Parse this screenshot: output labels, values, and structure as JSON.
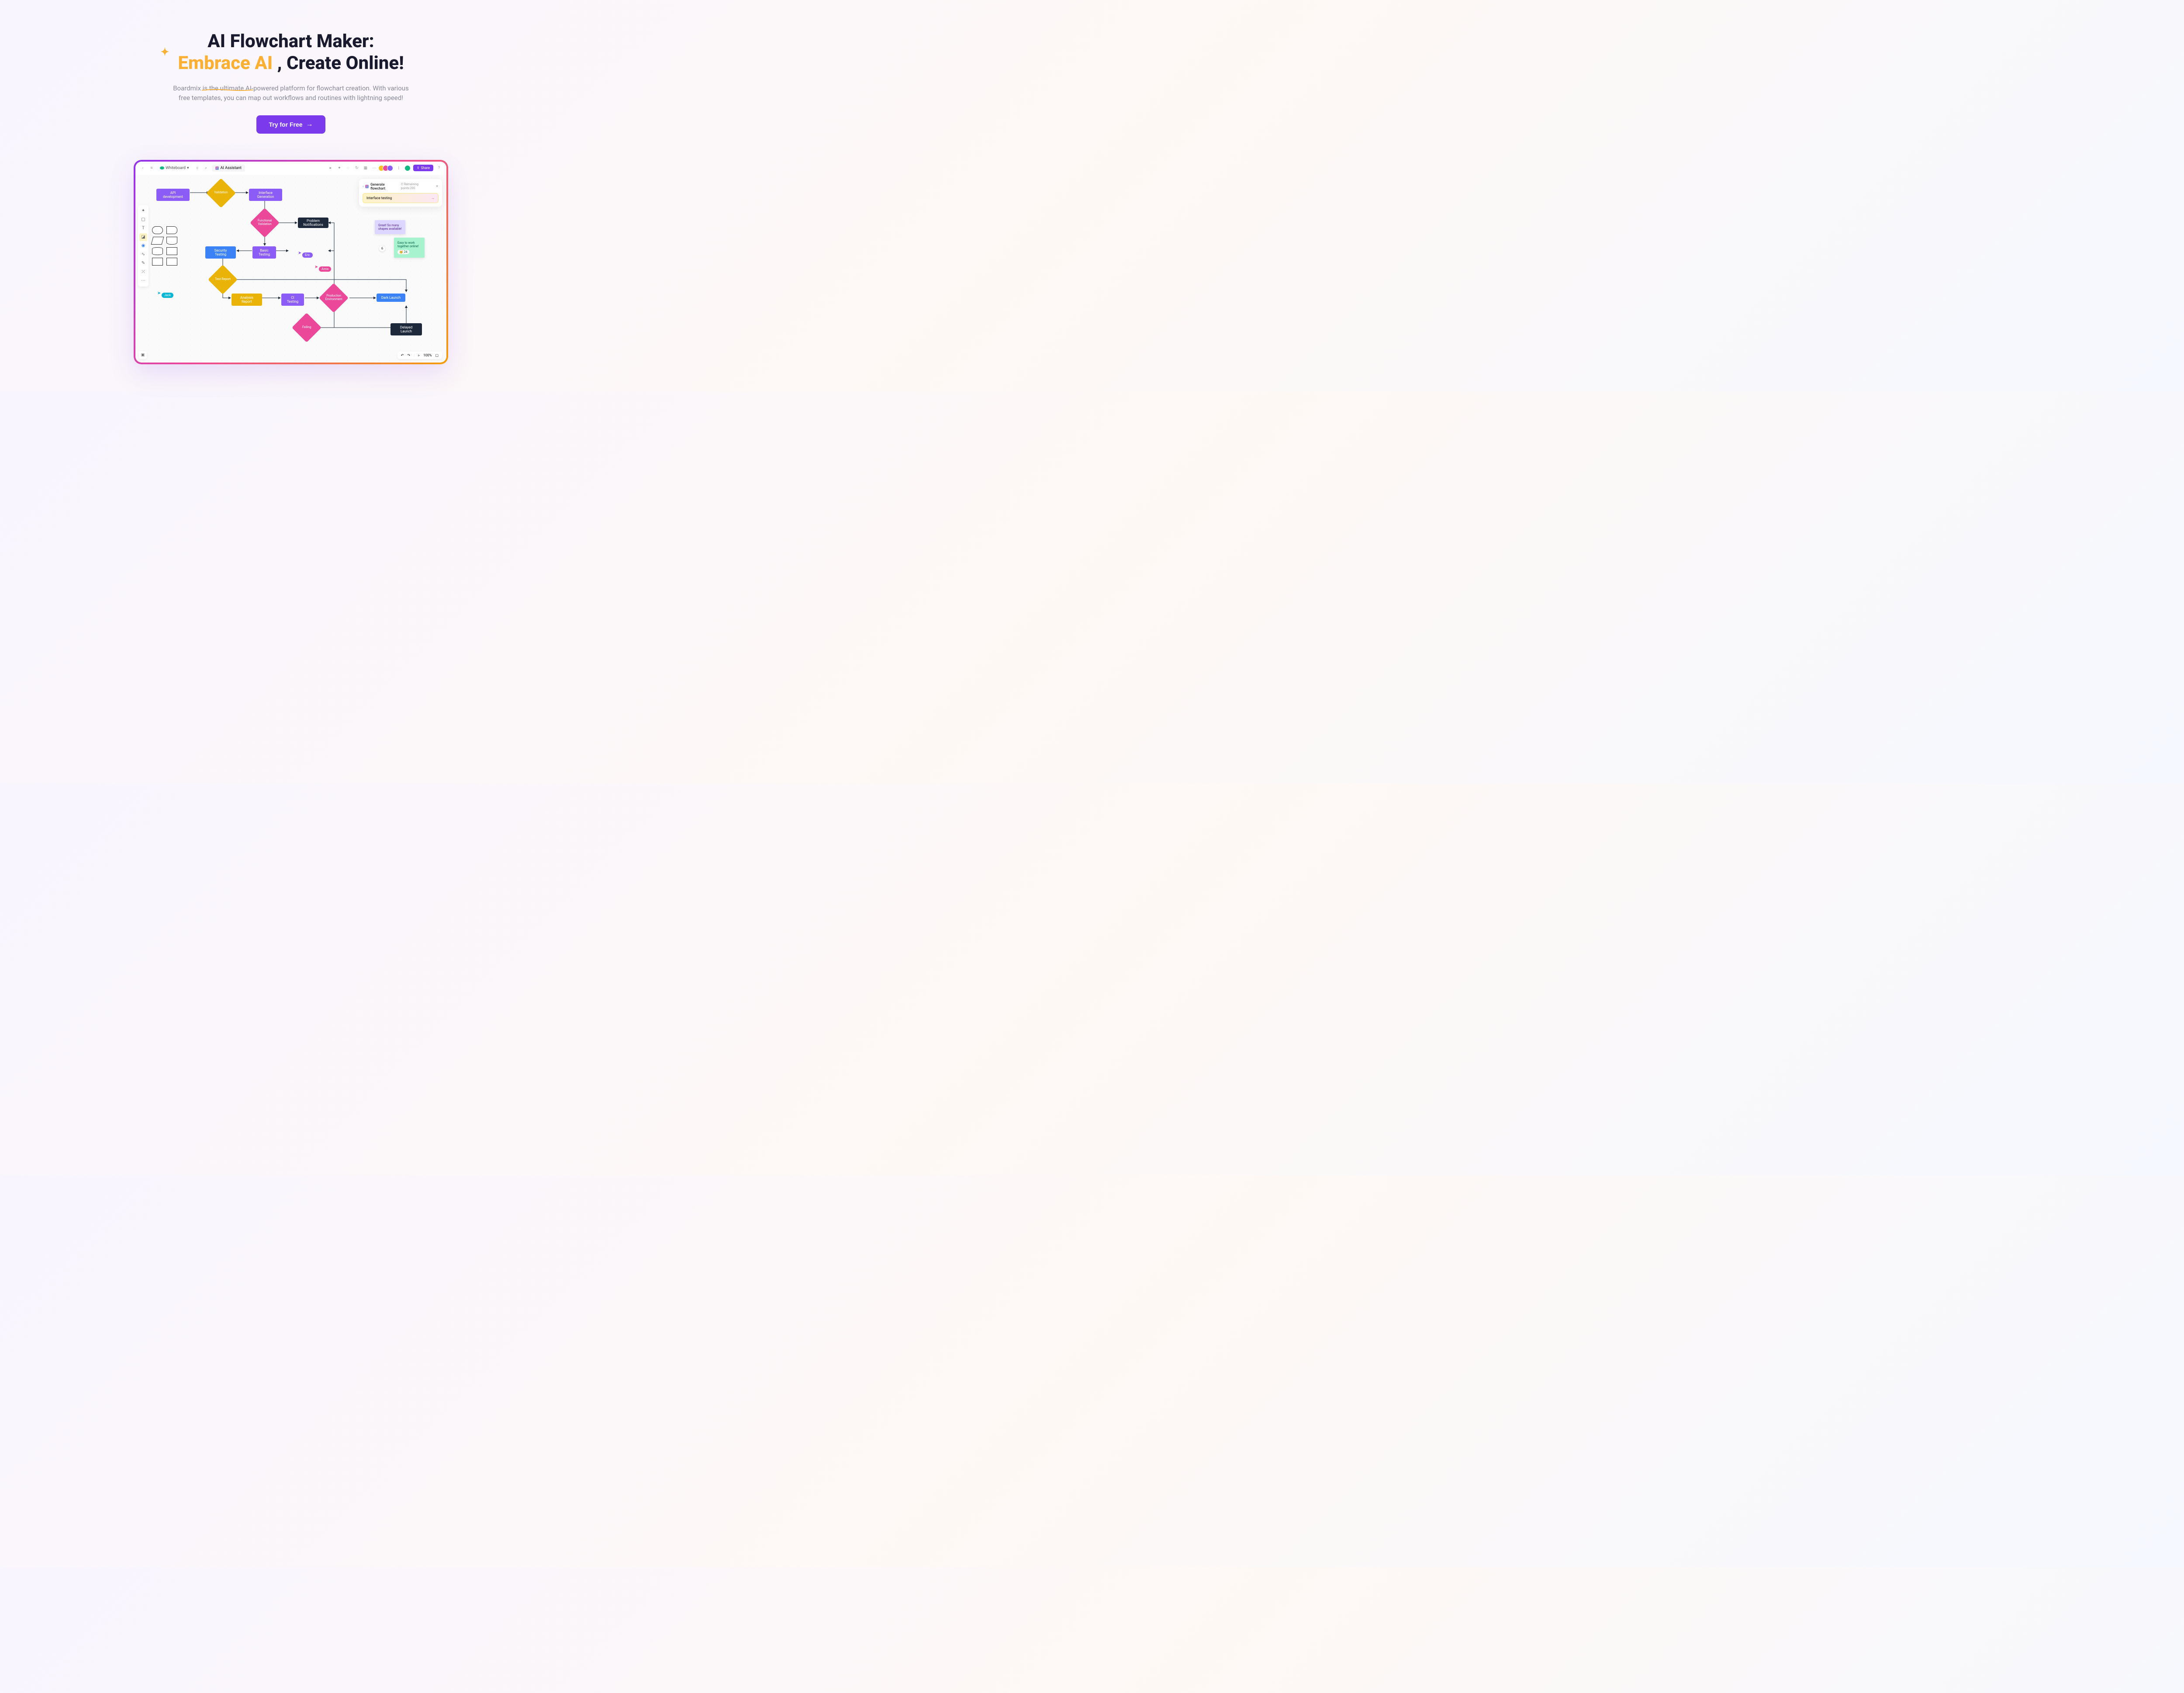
{
  "hero": {
    "title_pre": "AI Flowchart Maker:",
    "title_highlight": "Embrace AI",
    "title_post": ", Create Online!",
    "subtitle": "Boardmix is the ultimate AI-powered platform for flowchart creation. With various free templates, you can map out workflows and routines with lightning speed!",
    "cta": "Try for Free"
  },
  "toolbar": {
    "board_name": "Whiteboard",
    "ai_label": "AI Assistant",
    "share": "Share"
  },
  "ai_panel": {
    "title": "Generate flowchart",
    "points": "Remaining points:200",
    "input": "Interface testing"
  },
  "nodes": {
    "api": "API development",
    "validation": "Validation",
    "interface_gen": "Interface Generation",
    "functional": "Functional Validation",
    "problem": "Problem Notifications",
    "security": "Security Testing",
    "basic": "Basic Testing",
    "test_report": "Test Report",
    "analysis": "Analysis Report",
    "ci": "CI Testing",
    "production": "Production Environment",
    "dark_launch": "Dark Launch",
    "failing": "Failing",
    "delayed": "Delayed Launch"
  },
  "cursors": {
    "jack": "Jack",
    "eric": "Eric",
    "anna": "Anna"
  },
  "stickies": {
    "purple": "Great! So many shapes available!",
    "green": "Easy to work together online!",
    "count1": "6",
    "count2": "24"
  },
  "bottom": {
    "zoom": "100%"
  }
}
